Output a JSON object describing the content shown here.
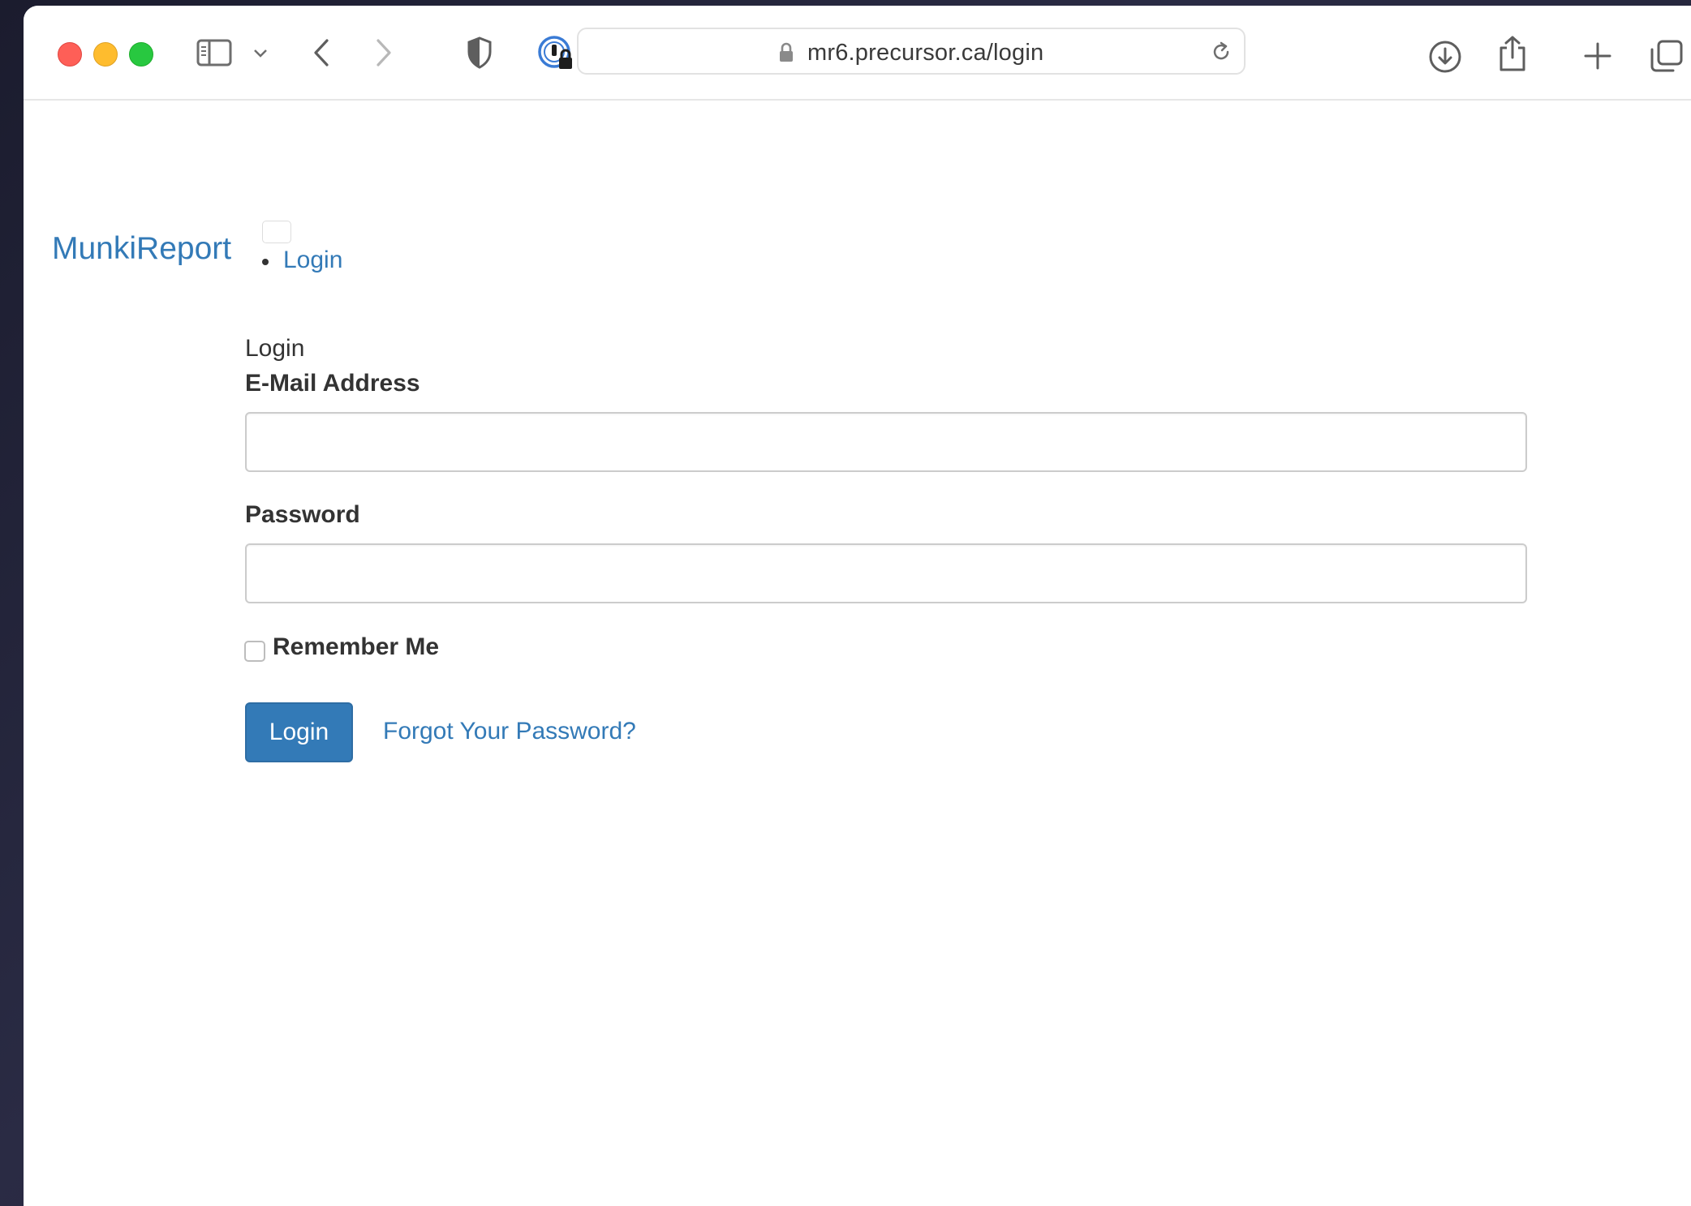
{
  "browser": {
    "url": "mr6.precursor.ca/login",
    "icons": [
      "sidebar-icon",
      "chevron-down-icon",
      "back-icon",
      "forward-icon",
      "privacy-shield-icon",
      "password-manager-icon",
      "lock-icon",
      "reload-icon",
      "download-icon",
      "share-icon",
      "new-tab-icon",
      "tab-overview-icon"
    ]
  },
  "navbar": {
    "brand": "MunkiReport",
    "links": [
      {
        "label": "Login"
      }
    ]
  },
  "form": {
    "title": "Login",
    "email_label": "E-Mail Address",
    "email_value": "",
    "password_label": "Password",
    "password_value": "",
    "remember_label": "Remember Me",
    "remember_checked": false,
    "submit_label": "Login",
    "forgot_label": "Forgot Your Password?"
  },
  "colors": {
    "link": "#337ab7",
    "primary_button": "#337ab7",
    "traffic_close": "#fe5f57",
    "traffic_minimize": "#febc2e",
    "traffic_maximize": "#28c840"
  }
}
